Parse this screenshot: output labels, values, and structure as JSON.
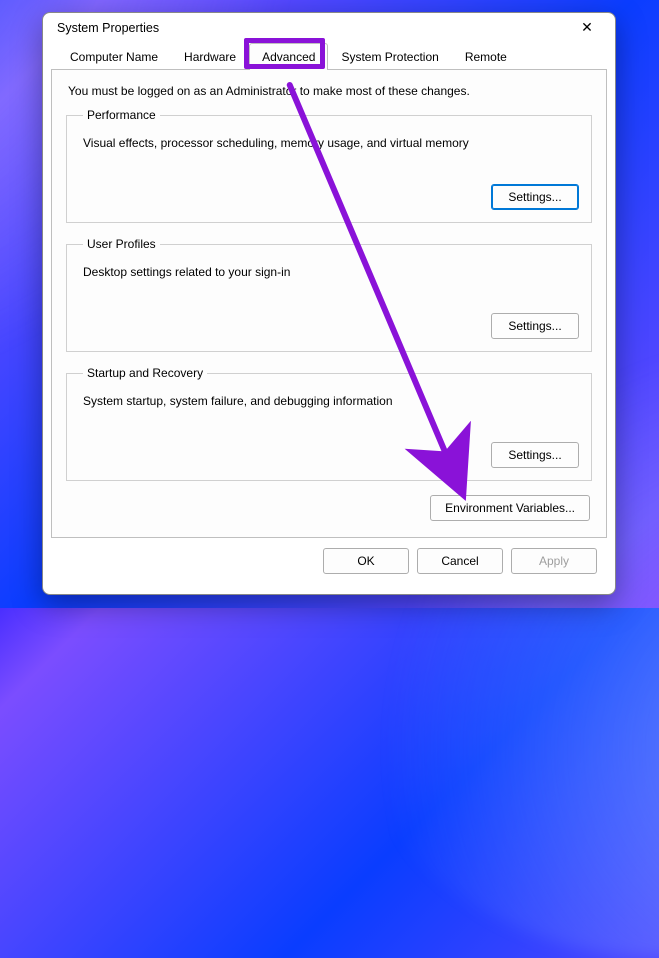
{
  "window": {
    "title": "System Properties",
    "close_glyph": "✕"
  },
  "tabs": {
    "computer_name": "Computer Name",
    "hardware": "Hardware",
    "advanced": "Advanced",
    "system_protection": "System Protection",
    "remote": "Remote",
    "active": "advanced"
  },
  "intro": "You must be logged on as an Administrator to make most of these changes.",
  "groups": {
    "performance": {
      "legend": "Performance",
      "desc": "Visual effects, processor scheduling, memory usage, and virtual memory",
      "button": "Settings..."
    },
    "user_profiles": {
      "legend": "User Profiles",
      "desc": "Desktop settings related to your sign-in",
      "button": "Settings..."
    },
    "startup": {
      "legend": "Startup and Recovery",
      "desc": "System startup, system failure, and debugging information",
      "button": "Settings..."
    }
  },
  "env_button": "Environment Variables...",
  "dialog_buttons": {
    "ok": "OK",
    "cancel": "Cancel",
    "apply": "Apply"
  },
  "annotation": {
    "highlight_color": "#8a12d8",
    "arrow_color": "#8a12d8"
  }
}
